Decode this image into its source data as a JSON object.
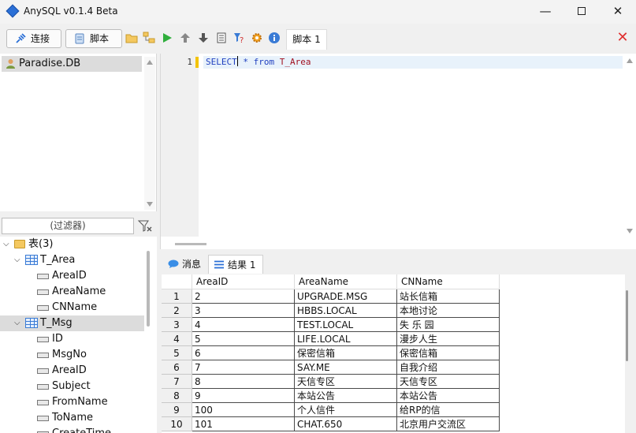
{
  "window": {
    "title": "AnySQL v0.1.4 Beta",
    "minimize": "—",
    "close": "✕"
  },
  "toolbar": {
    "connect_label": "连接",
    "script_label": "脚本",
    "tab_label": "脚本 1",
    "icons": [
      "open-folder-icon",
      "tree-icon",
      "run-icon",
      "upload-icon",
      "download-icon",
      "document-icon",
      "help-filter-icon",
      "settings-icon",
      "about-icon"
    ]
  },
  "db_panel": {
    "database": "Paradise.DB"
  },
  "filter": {
    "placeholder": "(过滤器)"
  },
  "tree": {
    "root": "表(3)",
    "tables": [
      {
        "name": "T_Area",
        "columns": [
          "AreaID",
          "AreaName",
          "CNName"
        ]
      },
      {
        "name": "T_Msg",
        "columns": [
          "ID",
          "MsgNo",
          "AreaID",
          "Subject",
          "FromName",
          "ToName",
          "CreateTime"
        ]
      }
    ]
  },
  "editor": {
    "line_number": "1",
    "sql": {
      "select": "SELECT",
      "star": " * ",
      "from": "from",
      "table": " T_Area"
    }
  },
  "results": {
    "tab_messages": "消息",
    "tab_results": "结果 1",
    "columns": [
      "AreaID",
      "AreaName",
      "CNName"
    ],
    "rows": [
      [
        "1",
        "2",
        "UPGRADE.MSG",
        "站长信箱"
      ],
      [
        "2",
        "3",
        "HBBS.LOCAL",
        "本地讨论"
      ],
      [
        "3",
        "4",
        "TEST.LOCAL",
        "失 乐 园"
      ],
      [
        "4",
        "5",
        "LIFE.LOCAL",
        "漫步人生"
      ],
      [
        "5",
        "6",
        "保密信箱",
        "保密信箱"
      ],
      [
        "6",
        "7",
        "SAY.ME",
        "自我介绍"
      ],
      [
        "7",
        "8",
        "天信专区",
        "天信专区"
      ],
      [
        "8",
        "9",
        "本站公告",
        "本站公告"
      ],
      [
        "9",
        "100",
        "个人信件",
        "给RP的信"
      ],
      [
        "10",
        "101",
        "CHAT.650",
        "北京用户交流区"
      ]
    ]
  }
}
